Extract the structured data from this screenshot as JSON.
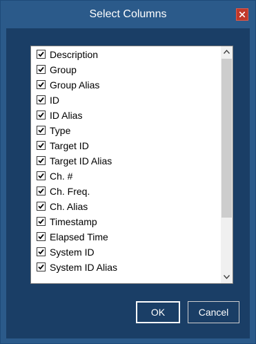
{
  "window": {
    "title": "Select Columns"
  },
  "columns": [
    {
      "label": "Description",
      "checked": true
    },
    {
      "label": "Group",
      "checked": true
    },
    {
      "label": "Group Alias",
      "checked": true
    },
    {
      "label": "ID",
      "checked": true
    },
    {
      "label": "ID Alias",
      "checked": true
    },
    {
      "label": "Type",
      "checked": true
    },
    {
      "label": "Target ID",
      "checked": true
    },
    {
      "label": "Target ID Alias",
      "checked": true
    },
    {
      "label": "Ch. #",
      "checked": true
    },
    {
      "label": "Ch. Freq.",
      "checked": true
    },
    {
      "label": "Ch. Alias",
      "checked": true
    },
    {
      "label": "Timestamp",
      "checked": true
    },
    {
      "label": "Elapsed Time",
      "checked": true
    },
    {
      "label": "System ID",
      "checked": true
    },
    {
      "label": "System ID Alias",
      "checked": true
    }
  ],
  "buttons": {
    "ok_label": "OK",
    "cancel_label": "Cancel"
  },
  "icons": {
    "close": "close-icon",
    "checkmark": "checkmark-icon",
    "scroll_up": "chevron-up-icon",
    "scroll_down": "chevron-down-icon"
  },
  "colors": {
    "title_bar": "#2b5a8a",
    "client_bg": "#1a3e66",
    "close_button": "#c0392b"
  }
}
